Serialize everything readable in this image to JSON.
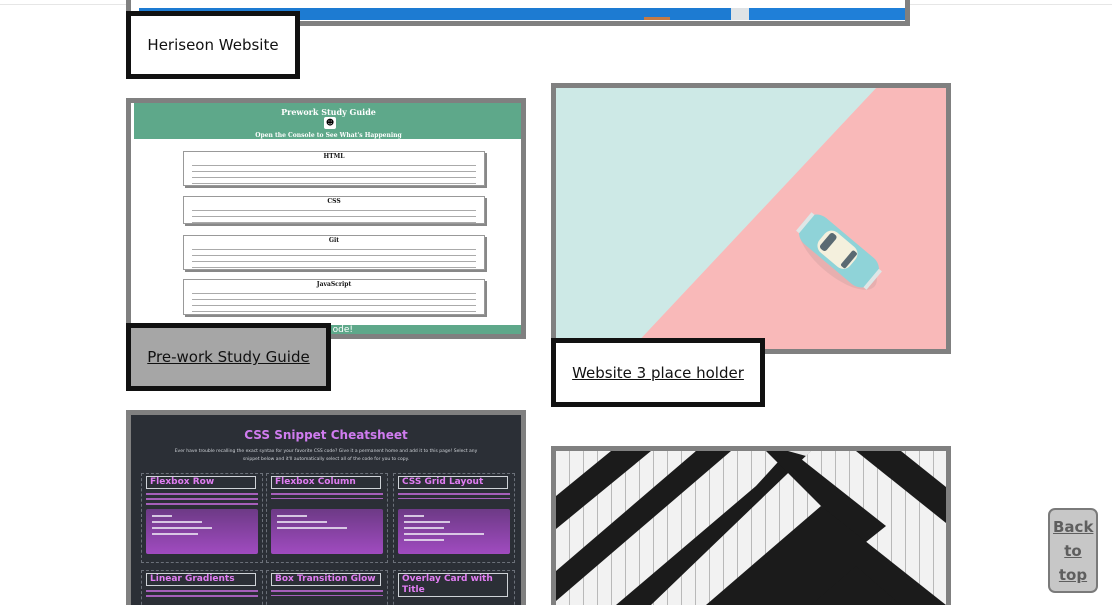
{
  "projects": {
    "heriseon": {
      "label": "Heriseon Website"
    },
    "prework": {
      "label": "Pre-work Study Guide",
      "thumb": {
        "title": "Prework Study Guide",
        "subtitle": "Open the Console to See What's Happening",
        "sections": [
          "HTML",
          "CSS",
          "Git",
          "JavaScript"
        ],
        "footer": "ode!"
      }
    },
    "website3": {
      "label": "Website 3 place holder"
    },
    "cheatsheet": {
      "thumb": {
        "title": "CSS Snippet Cheatsheet",
        "description": "Ever have trouble recalling the exact syntax for your favorite CSS code? Give it a permanent home and add it to this page! Select any snippet below and it'll automatically select all of the code for you to copy.",
        "panels": [
          "Flexbox Row",
          "Flexbox Column",
          "CSS Grid Layout",
          "Linear Gradients",
          "Box Transition Glow",
          "Overlay Card with Title"
        ]
      }
    },
    "stripes": {}
  },
  "back_to_top": {
    "label": "Back to top"
  },
  "colors": {
    "border_gray": "#808080",
    "label_border": "#111111",
    "prework_green": "#5ea88a",
    "cheatsheet_bg": "#2b2f36",
    "cheatsheet_accent": "#d07cf0",
    "mint": "#cbe9e5",
    "pink": "#f9b9b9"
  }
}
